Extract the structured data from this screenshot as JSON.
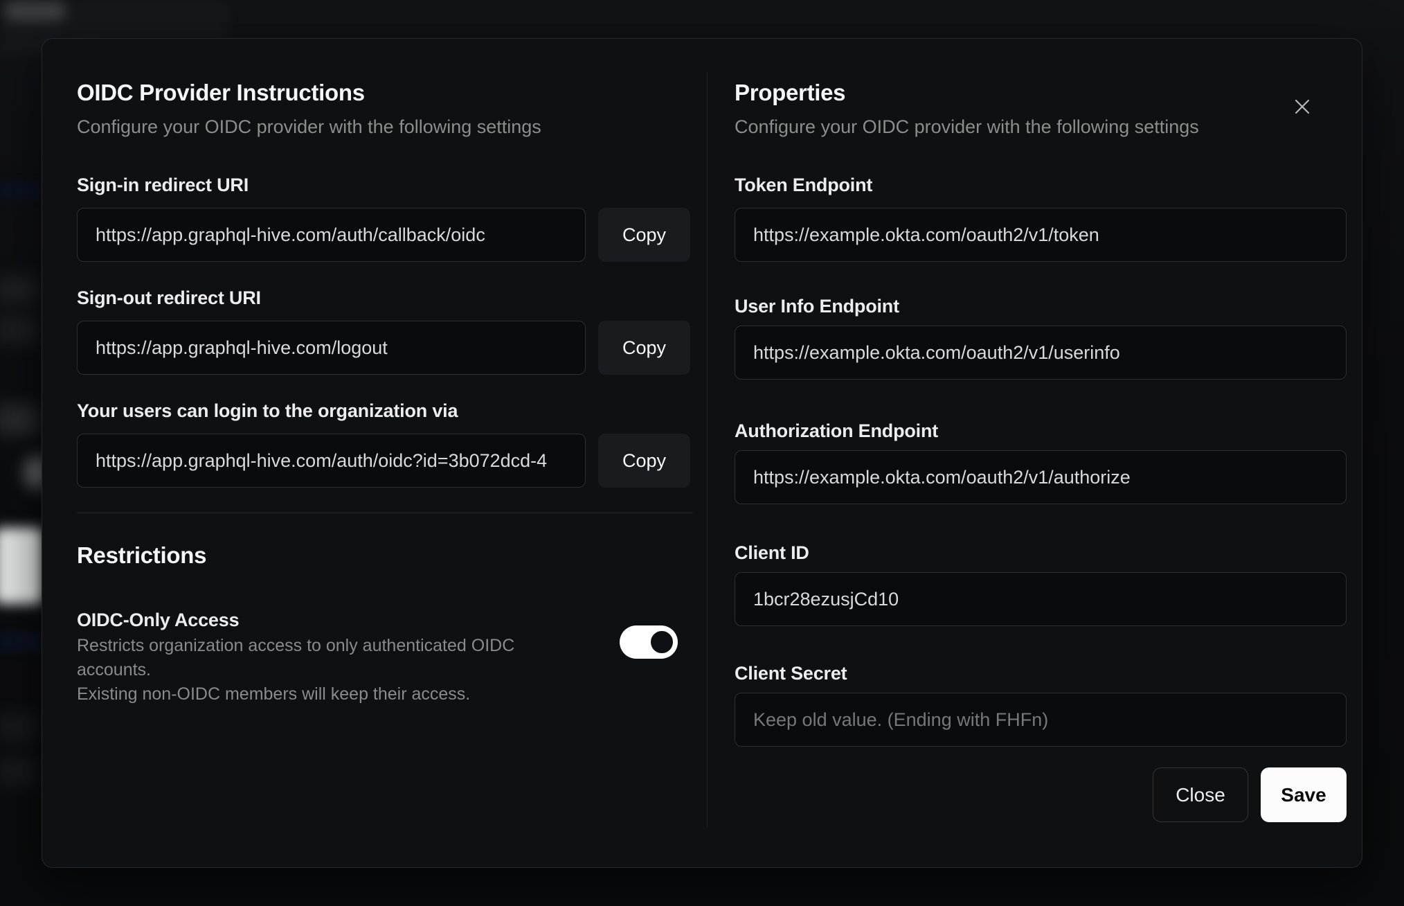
{
  "modal": {
    "left": {
      "title": "OIDC Provider Instructions",
      "subtitle": "Configure your OIDC provider with the following settings",
      "fields": [
        {
          "label": "Sign-in redirect URI",
          "value": "https://app.graphql-hive.com/auth/callback/oidc",
          "copy_label": "Copy"
        },
        {
          "label": "Sign-out redirect URI",
          "value": "https://app.graphql-hive.com/logout",
          "copy_label": "Copy"
        },
        {
          "label": "Your users can login to the organization via",
          "value": "https://app.graphql-hive.com/auth/oidc?id=3b072dcd-4",
          "copy_label": "Copy"
        }
      ],
      "restrictions": {
        "title": "Restrictions",
        "toggle_label": "OIDC-Only Access",
        "toggle_description_line1": "Restricts organization access to only authenticated OIDC accounts.",
        "toggle_description_line2": "Existing non-OIDC members will keep their access.",
        "toggle_state": "on"
      }
    },
    "right": {
      "title": "Properties",
      "subtitle": "Configure your OIDC provider with the following settings",
      "fields": [
        {
          "label": "Token Endpoint",
          "value": "https://example.okta.com/oauth2/v1/token"
        },
        {
          "label": "User Info Endpoint",
          "value": "https://example.okta.com/oauth2/v1/userinfo"
        },
        {
          "label": "Authorization Endpoint",
          "value": "https://example.okta.com/oauth2/v1/authorize"
        },
        {
          "label": "Client ID",
          "value": "1bcr28ezusjCd10"
        },
        {
          "label": "Client Secret",
          "value": "",
          "placeholder": "Keep old value. (Ending with FHFn)"
        }
      ],
      "buttons": {
        "close": "Close",
        "save": "Save"
      }
    },
    "icons": {
      "close": "close-icon"
    }
  },
  "colors": {
    "modal_background": "#0f1012",
    "input_background": "#0a0b0c",
    "copy_button_background": "#1a1b1e",
    "save_button_background": "#fcfcfc",
    "toggle_on": "#ffffff",
    "title_text": "#f5f6f7",
    "muted_text": "#8d8d8b"
  }
}
